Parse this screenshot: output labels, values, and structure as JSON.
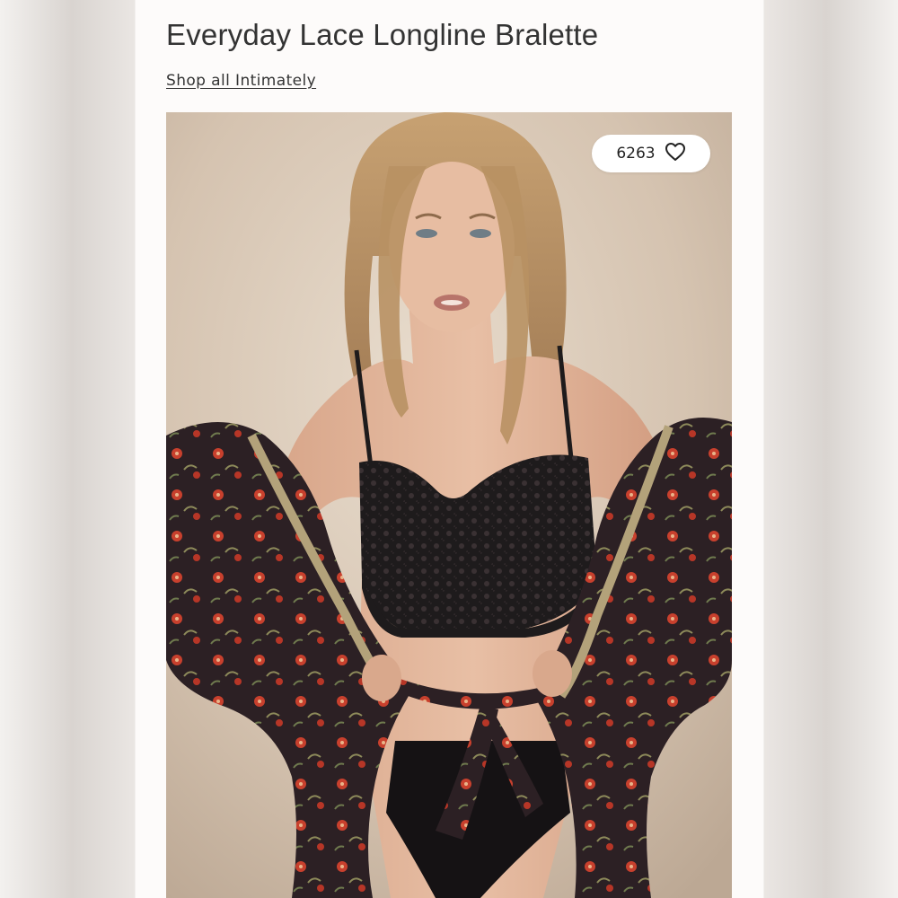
{
  "product": {
    "title": "Everyday Lace Longline Bralette",
    "shop_link_label": "Shop all Intimately"
  },
  "image": {
    "alt": "Everyday Lace Longline Bralette",
    "likes_count": "6263",
    "likes_icon": "heart-outline-icon"
  },
  "colors": {
    "background": "#fdfbfa",
    "text": "#333333",
    "photo_backdrop": "#d6c5b3",
    "bralette": "#1e1b1c",
    "robe": "#2c2024",
    "robe_flower": "#c8402d"
  }
}
